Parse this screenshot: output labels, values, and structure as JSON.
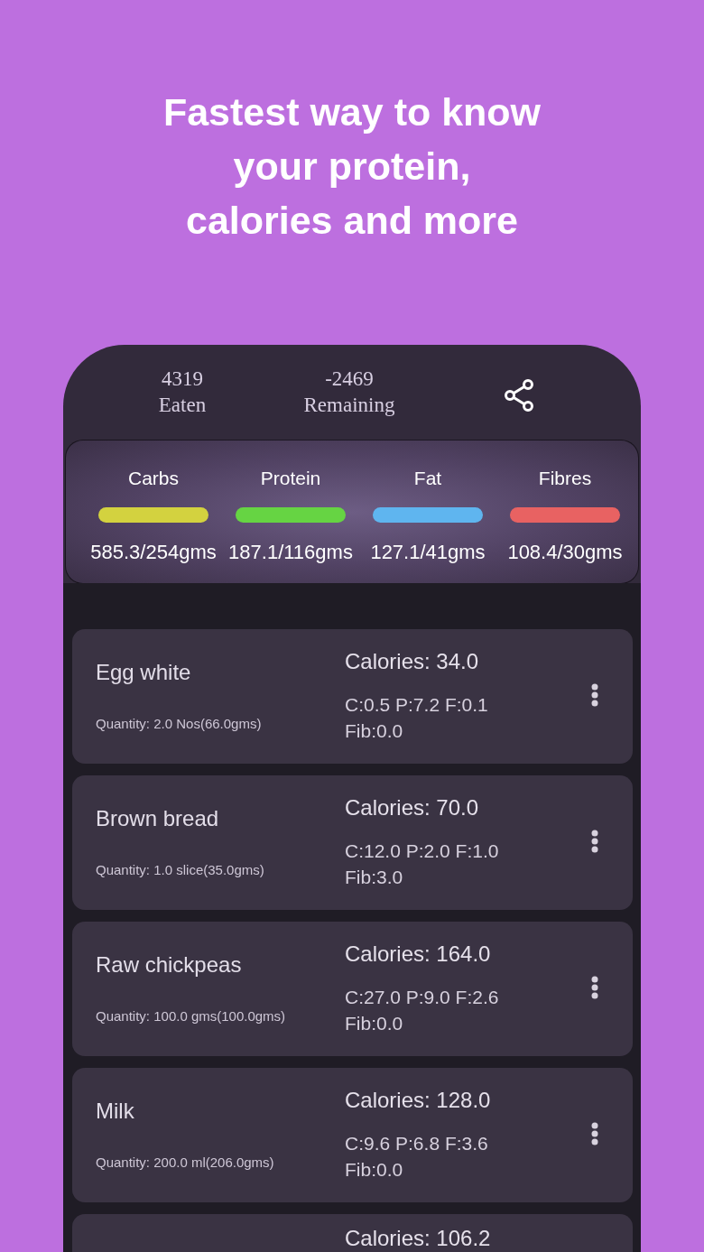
{
  "headline": "Fastest way to know\nyour protein,\ncalories and more",
  "stats": [
    {
      "value": "4319",
      "label": "Eaten"
    },
    {
      "value": "-2469",
      "label": "Remaining"
    }
  ],
  "macros": [
    {
      "label": "Carbs",
      "color": "#d3d23f",
      "amount": "585.3/254gms"
    },
    {
      "label": "Protein",
      "color": "#66d443",
      "amount": "187.1/116gms"
    },
    {
      "label": "Fat",
      "color": "#5fb5ef",
      "amount": "127.1/41gms"
    },
    {
      "label": "Fibres",
      "color": "#e86262",
      "amount": "108.4/30gms"
    }
  ],
  "foods": [
    {
      "name": "Egg white",
      "quantity": "Quantity: 2.0 Nos(66.0gms)",
      "calories": "Calories: 34.0",
      "nutrients": "C:0.5 P:7.2 F:0.1 Fib:0.0"
    },
    {
      "name": "Brown bread",
      "quantity": "Quantity: 1.0 slice(35.0gms)",
      "calories": "Calories: 70.0",
      "nutrients": "C:12.0 P:2.0 F:1.0 Fib:3.0"
    },
    {
      "name": "Raw chickpeas",
      "quantity": "Quantity: 100.0 gms(100.0gms)",
      "calories": "Calories: 164.0",
      "nutrients": "C:27.0 P:9.0 F:2.6 Fib:0.0"
    },
    {
      "name": "Milk",
      "quantity": "Quantity: 200.0 ml(206.0gms)",
      "calories": "Calories: 128.0",
      "nutrients": "C:9.6 P:6.8 F:3.6 Fib:0.0"
    },
    {
      "calories": "Calories: 106.2"
    }
  ]
}
